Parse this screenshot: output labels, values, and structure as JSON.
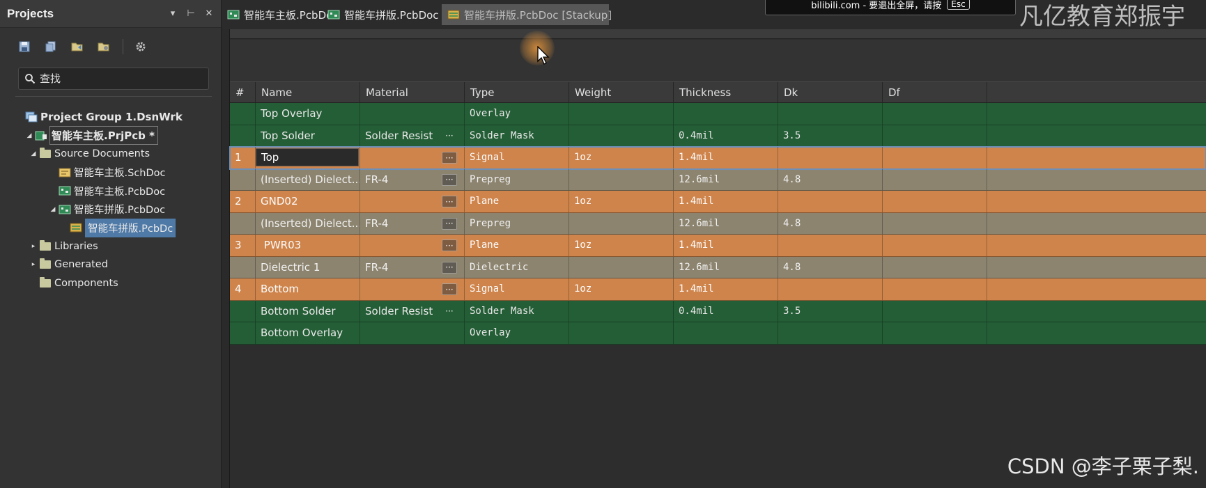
{
  "panel": {
    "title": "Projects",
    "controls": [
      "▾",
      "⊢",
      "✕"
    ],
    "search_placeholder": "查找"
  },
  "tree": [
    {
      "label": "Project Group 1.DsnWrk",
      "level": 0,
      "arrow": "",
      "icon": "project-group-icon",
      "style": "bold"
    },
    {
      "label": "智能车主板.PrjPcb *",
      "level": 1,
      "arrow": "◢",
      "icon": "pcb-project-icon",
      "style": "bold sel-outline"
    },
    {
      "label": "Source Documents",
      "level": 2,
      "arrow": "◢",
      "icon": "folder-icon",
      "style": ""
    },
    {
      "label": "智能车主板.SchDoc",
      "level": 3,
      "arrow": "",
      "icon": "schematic-doc-icon",
      "style": ""
    },
    {
      "label": "智能车主板.PcbDoc",
      "level": 3,
      "arrow": "",
      "icon": "pcb-doc-icon",
      "style": ""
    },
    {
      "label": "智能车拼版.PcbDoc",
      "level": 3,
      "arrow": "◢",
      "icon": "pcb-doc-icon",
      "style": ""
    },
    {
      "label": "智能车拼版.PcbDc",
      "level": 4,
      "arrow": "",
      "icon": "stackup-doc-icon",
      "style": "sel-blue"
    },
    {
      "label": "Libraries",
      "level": 2,
      "arrow": "▸",
      "icon": "folder-icon",
      "style": ""
    },
    {
      "label": "Generated",
      "level": 2,
      "arrow": "▸",
      "icon": "folder-icon",
      "style": ""
    },
    {
      "label": "Components",
      "level": 2,
      "arrow": "",
      "icon": "folder-icon",
      "style": ""
    }
  ],
  "tabs": [
    {
      "label": "智能车主板.PcbDoc",
      "icon": "pcb-doc-icon",
      "active": false
    },
    {
      "label": "智能车拼版.PcbDoc *",
      "icon": "pcb-doc-icon",
      "active": false
    },
    {
      "label": "智能车拼版.PcbDoc [Stackup]",
      "icon": "stackup-doc-icon",
      "active": true
    }
  ],
  "overlay": {
    "watermark": "凡亿教育郑振宇",
    "fullscreen_notice": "bilibili.com - 要退出全屏，请按",
    "fullscreen_key": "Esc",
    "csdn": "CSDN @李子栗子梨."
  },
  "grid": {
    "headers": [
      "#",
      "Name",
      "Material",
      "Type",
      "Weight",
      "Thickness",
      "Dk",
      "Df"
    ],
    "rows": [
      {
        "num": "",
        "name": "Top Overlay",
        "material": "",
        "type": "Overlay",
        "weight": "",
        "thickness": "",
        "dk": "",
        "df": "",
        "kind": "green",
        "ell": "none"
      },
      {
        "num": "",
        "name": "Top Solder",
        "material": "Solder Resist",
        "type": "Solder Mask",
        "weight": "",
        "thickness": "0.4mil",
        "dk": "3.5",
        "df": "",
        "kind": "green",
        "ell": "plain"
      },
      {
        "num": "1",
        "name": "Top",
        "material": "",
        "type": "Signal",
        "weight": "1oz",
        "thickness": "1.4mil",
        "dk": "",
        "df": "",
        "kind": "orange",
        "ell": "boxed",
        "editing": true
      },
      {
        "num": "",
        "name": "(Inserted) Dielect...",
        "material": "FR-4",
        "type": "Prepreg",
        "weight": "",
        "thickness": "12.6mil",
        "dk": "4.8",
        "df": "",
        "kind": "gray",
        "ell": "boxed"
      },
      {
        "num": "2",
        "name": "GND02",
        "material": "",
        "type": "Plane",
        "weight": "1oz",
        "thickness": "1.4mil",
        "dk": "",
        "df": "",
        "kind": "orange",
        "ell": "boxed"
      },
      {
        "num": "",
        "name": "(Inserted) Dielect...",
        "material": "FR-4",
        "type": "Prepreg",
        "weight": "",
        "thickness": "12.6mil",
        "dk": "4.8",
        "df": "",
        "kind": "gray",
        "ell": "boxed"
      },
      {
        "num": "3",
        "name": " PWR03",
        "material": "",
        "type": "Plane",
        "weight": "1oz",
        "thickness": "1.4mil",
        "dk": "",
        "df": "",
        "kind": "orange",
        "ell": "boxed"
      },
      {
        "num": "",
        "name": "Dielectric 1",
        "material": "FR-4",
        "type": "Dielectric",
        "weight": "",
        "thickness": "12.6mil",
        "dk": "4.8",
        "df": "",
        "kind": "gray",
        "ell": "boxed"
      },
      {
        "num": "4",
        "name": "Bottom",
        "material": "",
        "type": "Signal",
        "weight": "1oz",
        "thickness": "1.4mil",
        "dk": "",
        "df": "",
        "kind": "orange",
        "ell": "boxed"
      },
      {
        "num": "",
        "name": "Bottom Solder",
        "material": "Solder Resist",
        "type": "Solder Mask",
        "weight": "",
        "thickness": "0.4mil",
        "dk": "3.5",
        "df": "",
        "kind": "green",
        "ell": "plain"
      },
      {
        "num": "",
        "name": "Bottom Overlay",
        "material": "",
        "type": "Overlay",
        "weight": "",
        "thickness": "",
        "dk": "",
        "df": "",
        "kind": "green",
        "ell": "none"
      }
    ]
  },
  "colors": {
    "row_green": "#245e36",
    "row_orange": "#cf844b",
    "row_gray": "#8c846f",
    "selection_blue": "#4f7aa7"
  }
}
